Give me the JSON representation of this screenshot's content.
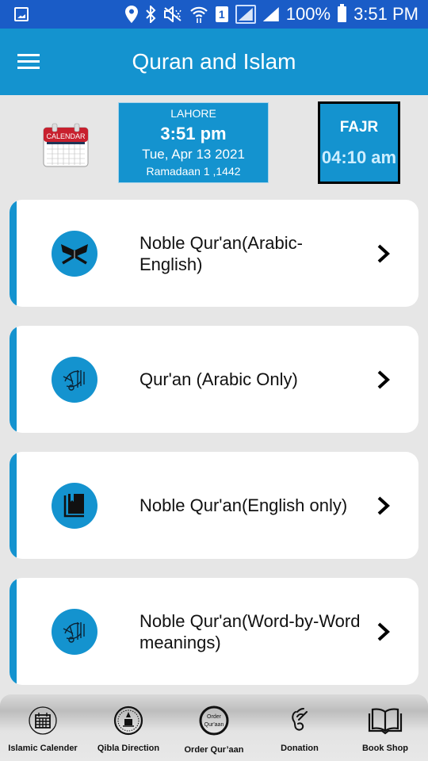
{
  "status_bar": {
    "icons": [
      "gallery-icon",
      "location-icon",
      "bluetooth-icon",
      "mute-icon",
      "wifi-icon",
      "sim-1-icon",
      "signal-box-icon",
      "signal-icon",
      "battery-icon"
    ],
    "sim_label": "1",
    "battery": "100%",
    "time": "3:51 PM"
  },
  "app_bar": {
    "title": "Quran and Islam",
    "menu_icon": "hamburger-menu-icon"
  },
  "info": {
    "calendar_label": "CALENDAR",
    "city": "LAHORE",
    "time": "3:51 pm",
    "date": "Tue, Apr 13 2021",
    "hijri_date": "Ramadaan 1 ,1442",
    "next_prayer": {
      "name": "FAJR",
      "time": "04:10 am"
    }
  },
  "menu_cards": [
    {
      "label": "Noble Qur'an(Arabic-English)",
      "icon": "quran-stand-icon"
    },
    {
      "label": "Qur'an (Arabic Only)",
      "icon": "quran-calligraphy-icon"
    },
    {
      "label": "Noble Qur'an(English only)",
      "icon": "book-icon"
    },
    {
      "label": "Noble Qur'an(Word-by-Word meanings)",
      "icon": "quran-calligraphy-icon"
    }
  ],
  "bottom_nav": [
    {
      "label": "Islamic Calender",
      "icon": "calendar-icon"
    },
    {
      "label": "Qibla Direction",
      "icon": "qibla-compass-icon"
    },
    {
      "label": "Order Qur’aan",
      "icon": "order-quran-icon",
      "icon_text_1": "Order",
      "icon_text_2": "Qur'aan"
    },
    {
      "label": "Donation",
      "icon": "donation-hand-icon"
    },
    {
      "label": "Book Shop",
      "icon": "open-book-icon"
    }
  ],
  "colors": {
    "status_bar": "#1a5cc7",
    "primary": "#1493cf",
    "background": "#e6e6e6",
    "card": "#ffffff"
  }
}
